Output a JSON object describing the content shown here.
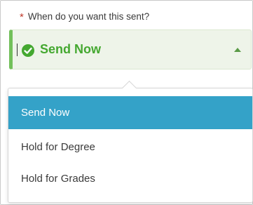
{
  "field": {
    "required_marker": "*",
    "label": "When do you want this sent?"
  },
  "select": {
    "selected_value": "Send Now",
    "status_icon": "check-circle-icon",
    "toggle_icon": "caret-up-icon",
    "accent_color": "#44a830",
    "valid_border_color": "#72c05a"
  },
  "dropdown": {
    "highlight_color": "#34a2c8",
    "options": [
      {
        "label": "Send Now",
        "highlighted": true
      },
      {
        "label": "Hold for Degree",
        "highlighted": false
      },
      {
        "label": "Hold for Grades",
        "highlighted": false
      }
    ]
  }
}
